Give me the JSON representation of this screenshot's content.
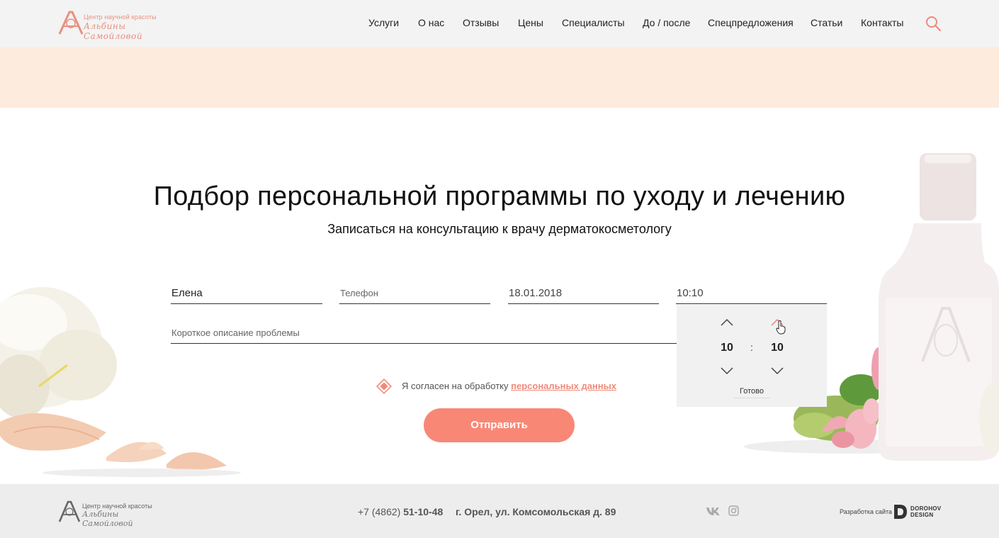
{
  "header": {
    "logo": {
      "line1": "Центр научной красоты",
      "line2": "Альбины Самойловой"
    },
    "nav": [
      "Услуги",
      "О нас",
      "Отзывы",
      "Цены",
      "Специалисты",
      "До / после",
      "Спецпредложения",
      "Статьи",
      "Контакты"
    ]
  },
  "main": {
    "title": "Подбор персональной программы по уходу и лечению",
    "subtitle": "Записаться на консультацию к врачу дерматокосметологу",
    "form": {
      "name_value": "Елена",
      "phone_placeholder": "Телефон",
      "date_value": "18.01.2018",
      "time_value": "10:10",
      "description_placeholder": "Короткое описание проблемы",
      "consent_text": "Я согласен на обработку ",
      "consent_link": "персональных данных",
      "submit_label": "Отправить"
    },
    "timepicker": {
      "hours": "10",
      "separator": ":",
      "minutes": "10",
      "done_label": "Готово"
    }
  },
  "footer": {
    "logo": {
      "line1": "Центр научной красоты",
      "line2": "Альбины Самойловой"
    },
    "phone_prefix": "+7 (4862) ",
    "phone_number": "51-10-48",
    "address": "г. Орел, ул. Комсомольская д. 89",
    "developer_label": "Разработка сайта",
    "developer_name_1": "DOROHOV",
    "developer_name_2": "DESIGN"
  },
  "colors": {
    "accent": "#f98776",
    "banner": "#fdebdd",
    "header_bg": "#f3f3f3",
    "footer_bg": "#ededed"
  }
}
